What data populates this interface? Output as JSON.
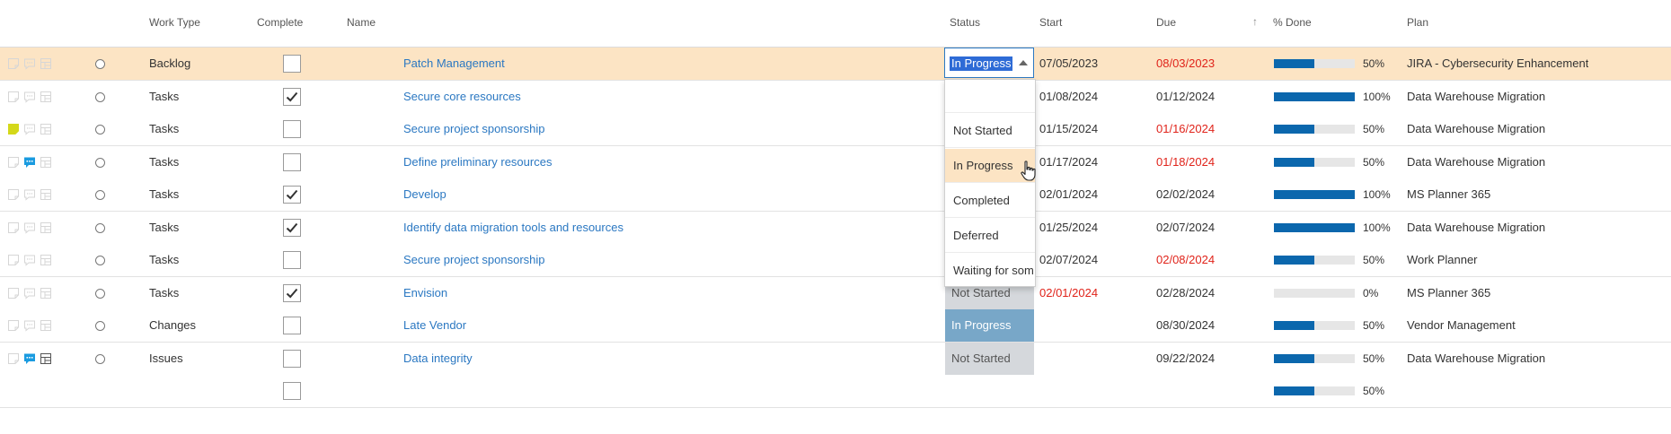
{
  "headers": {
    "work_type": "Work Type",
    "complete": "Complete",
    "name": "Name",
    "status": "Status",
    "start": "Start",
    "due": "Due",
    "pct_done": "% Done",
    "plan": "Plan"
  },
  "colors": {
    "link": "#2b78c2",
    "overdue": "#e0231a",
    "selected_row": "#fce4c4",
    "progress": "#0b67ad",
    "status_in_progress": "#78a7c8",
    "status_not_started": "#d5d8dc",
    "note_yellow": "#d4d81a",
    "comment_blue": "#1a9be0"
  },
  "status_editor": {
    "value": "In Progress"
  },
  "dropdown": {
    "options": [
      "",
      "Not Started",
      "In Progress",
      "Completed",
      "Deferred",
      "Waiting for som"
    ],
    "highlighted": "In Progress"
  },
  "rows": [
    {
      "work_type": "Backlog",
      "complete": false,
      "name": "Patch Management",
      "status": "In Progress",
      "start": "07/05/2023",
      "due": "08/03/2023",
      "due_overdue": true,
      "pct": "50%",
      "progress": 0.5,
      "plan": "JIRA - Cybersecurity Enhancement",
      "note": "none",
      "comment": "none",
      "selected": true
    },
    {
      "work_type": "Tasks",
      "complete": true,
      "name": "Secure core resources",
      "status": "",
      "start": "01/08/2024",
      "due": "01/12/2024",
      "due_overdue": false,
      "pct": "100%",
      "progress": 1.0,
      "plan": "Data Warehouse Migration",
      "note": "none",
      "comment": "none"
    },
    {
      "work_type": "Tasks",
      "complete": false,
      "name": "Secure project sponsorship",
      "status": "",
      "start": "01/15/2024",
      "due": "01/16/2024",
      "due_overdue": true,
      "pct": "50%",
      "progress": 0.5,
      "plan": "Data Warehouse Migration",
      "note": "yellow",
      "comment": "none"
    },
    {
      "work_type": "Tasks",
      "complete": false,
      "name": "Define preliminary resources",
      "status": "",
      "start": "01/17/2024",
      "due": "01/18/2024",
      "due_overdue": true,
      "pct": "50%",
      "progress": 0.5,
      "plan": "Data Warehouse Migration",
      "note": "none",
      "comment": "blue"
    },
    {
      "work_type": "Tasks",
      "complete": true,
      "name": "Develop",
      "status": "",
      "start": "02/01/2024",
      "due": "02/02/2024",
      "due_overdue": false,
      "pct": "100%",
      "progress": 1.0,
      "plan": "MS Planner 365",
      "note": "none",
      "comment": "none"
    },
    {
      "work_type": "Tasks",
      "complete": true,
      "name": "Identify data migration tools and resources",
      "status": "",
      "start": "01/25/2024",
      "due": "02/07/2024",
      "due_overdue": false,
      "pct": "100%",
      "progress": 1.0,
      "plan": "Data Warehouse Migration",
      "note": "none",
      "comment": "none"
    },
    {
      "work_type": "Tasks",
      "complete": false,
      "name": "Secure project sponsorship",
      "status": "",
      "start": "02/07/2024",
      "due": "02/08/2024",
      "due_overdue": true,
      "pct": "50%",
      "progress": 0.5,
      "plan": "Work Planner",
      "note": "none",
      "comment": "none"
    },
    {
      "work_type": "Tasks",
      "complete": true,
      "name": "Envision",
      "status": "Not Started",
      "start": "02/01/2024",
      "start_overdue": true,
      "due": "02/28/2024",
      "due_overdue": false,
      "pct": "0%",
      "progress": 0,
      "plan": "MS Planner 365",
      "note": "none",
      "comment": "none"
    },
    {
      "work_type": "Changes",
      "complete": false,
      "name": "Late Vendor",
      "status": "In Progress",
      "start": "",
      "due": "08/30/2024",
      "due_overdue": false,
      "pct": "50%",
      "progress": 0.5,
      "plan": "Vendor Management",
      "note": "none",
      "comment": "none"
    },
    {
      "work_type": "Issues",
      "complete": false,
      "name": "Data integrity",
      "status": "Not Started",
      "start": "",
      "due": "09/22/2024",
      "due_overdue": false,
      "pct": "50%",
      "progress": 0.5,
      "plan": "Data Warehouse Migration",
      "note": "none",
      "comment": "blue",
      "board_dark": true
    },
    {
      "work_type": "",
      "complete": false,
      "name": "",
      "status": "",
      "start": "",
      "due": "",
      "due_overdue": false,
      "pct": "50%",
      "progress": 0.5,
      "plan": "",
      "summary": true
    }
  ]
}
